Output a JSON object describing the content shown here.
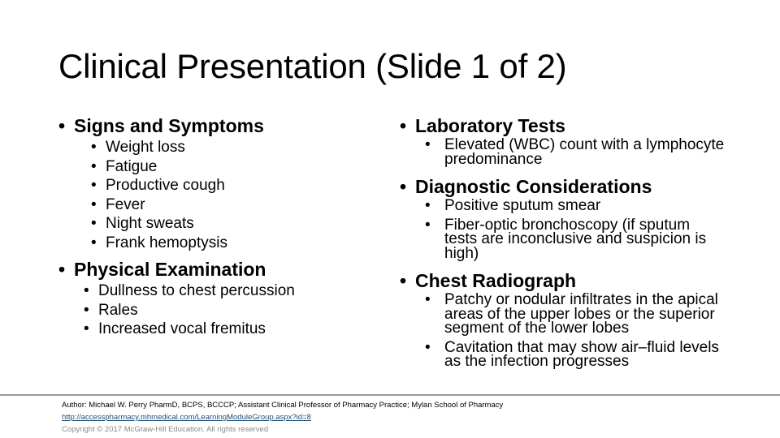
{
  "slide": {
    "title": "Clinical Presentation (Slide 1 of 2)",
    "bullet_glyph": "•",
    "left_column": [
      {
        "heading": "Signs and Symptoms",
        "items": [
          "Weight loss",
          "Fatigue",
          "Productive cough",
          "Fever",
          "Night sweats",
          "Frank hemoptysis"
        ]
      },
      {
        "heading": "Physical Examination",
        "items": [
          "Dullness to chest percussion",
          "Rales",
          "Increased vocal fremitus"
        ]
      }
    ],
    "right_column": [
      {
        "heading": "Laboratory Tests",
        "items": [
          "Elevated (WBC) count with a lymphocyte predominance"
        ]
      },
      {
        "heading": "Diagnostic Considerations",
        "items": [
          "Positive sputum smear",
          "Fiber-optic bronchoscopy (if sputum tests are inconclusive and suspicion is high)"
        ]
      },
      {
        "heading": "Chest Radiograph",
        "items": [
          "Patchy or nodular infiltrates in the apical areas of the upper lobes or the superior segment of the lower lobes",
          "Cavitation that may show air–fluid levels as the infection progresses"
        ]
      }
    ]
  },
  "footer": {
    "author": "Author: Michael W. Perry PharmD, BCPS, BCCCP; Assistant Clinical Professor of Pharmacy Practice; Mylan School of Pharmacy",
    "link": "http://accesspharmacy.mhmedical.com/LearningModuleGroup.aspx?id=8",
    "copyright": "Copyright © 2017 McGraw-Hill Education. All rights reserved"
  },
  "colors": {
    "text": "#000000",
    "link": "#1f4e79",
    "copyright": "#8a8a8a",
    "divider": "#9a9a9a"
  }
}
